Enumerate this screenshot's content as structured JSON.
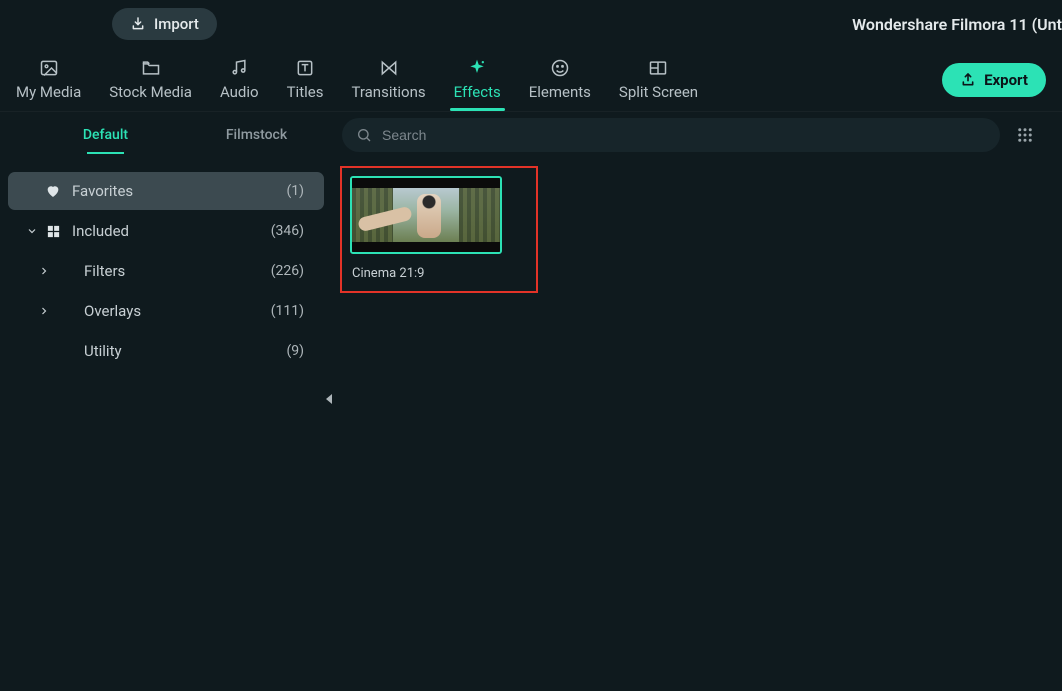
{
  "titlebar": {
    "import_label": "Import",
    "app_title": "Wondershare Filmora 11 (Unt"
  },
  "nav": {
    "tabs": [
      {
        "id": "my-media",
        "label": "My Media"
      },
      {
        "id": "stock-media",
        "label": "Stock Media"
      },
      {
        "id": "audio",
        "label": "Audio"
      },
      {
        "id": "titles",
        "label": "Titles"
      },
      {
        "id": "transitions",
        "label": "Transitions"
      },
      {
        "id": "effects",
        "label": "Effects"
      },
      {
        "id": "elements",
        "label": "Elements"
      },
      {
        "id": "split-screen",
        "label": "Split Screen"
      }
    ],
    "active_tab": "effects",
    "export_label": "Export"
  },
  "library_tabs": {
    "default_label": "Default",
    "filmstock_label": "Filmstock",
    "active": "default"
  },
  "search": {
    "placeholder": "Search",
    "value": ""
  },
  "sidebar": {
    "items": [
      {
        "id": "favorites",
        "label": "Favorites",
        "count": "(1)",
        "icon": "heart",
        "selected": true
      },
      {
        "id": "included",
        "label": "Included",
        "count": "(346)",
        "icon": "grid",
        "expandable": true,
        "expanded": true,
        "children": [
          {
            "id": "filters",
            "label": "Filters",
            "count": "(226)",
            "expandable": true
          },
          {
            "id": "overlays",
            "label": "Overlays",
            "count": "(111)",
            "expandable": true
          },
          {
            "id": "utility",
            "label": "Utility",
            "count": "(9)",
            "expandable": false
          }
        ]
      }
    ]
  },
  "grid": {
    "items": [
      {
        "id": "cinema-21-9",
        "label": "Cinema 21:9",
        "highlighted": true
      }
    ]
  }
}
